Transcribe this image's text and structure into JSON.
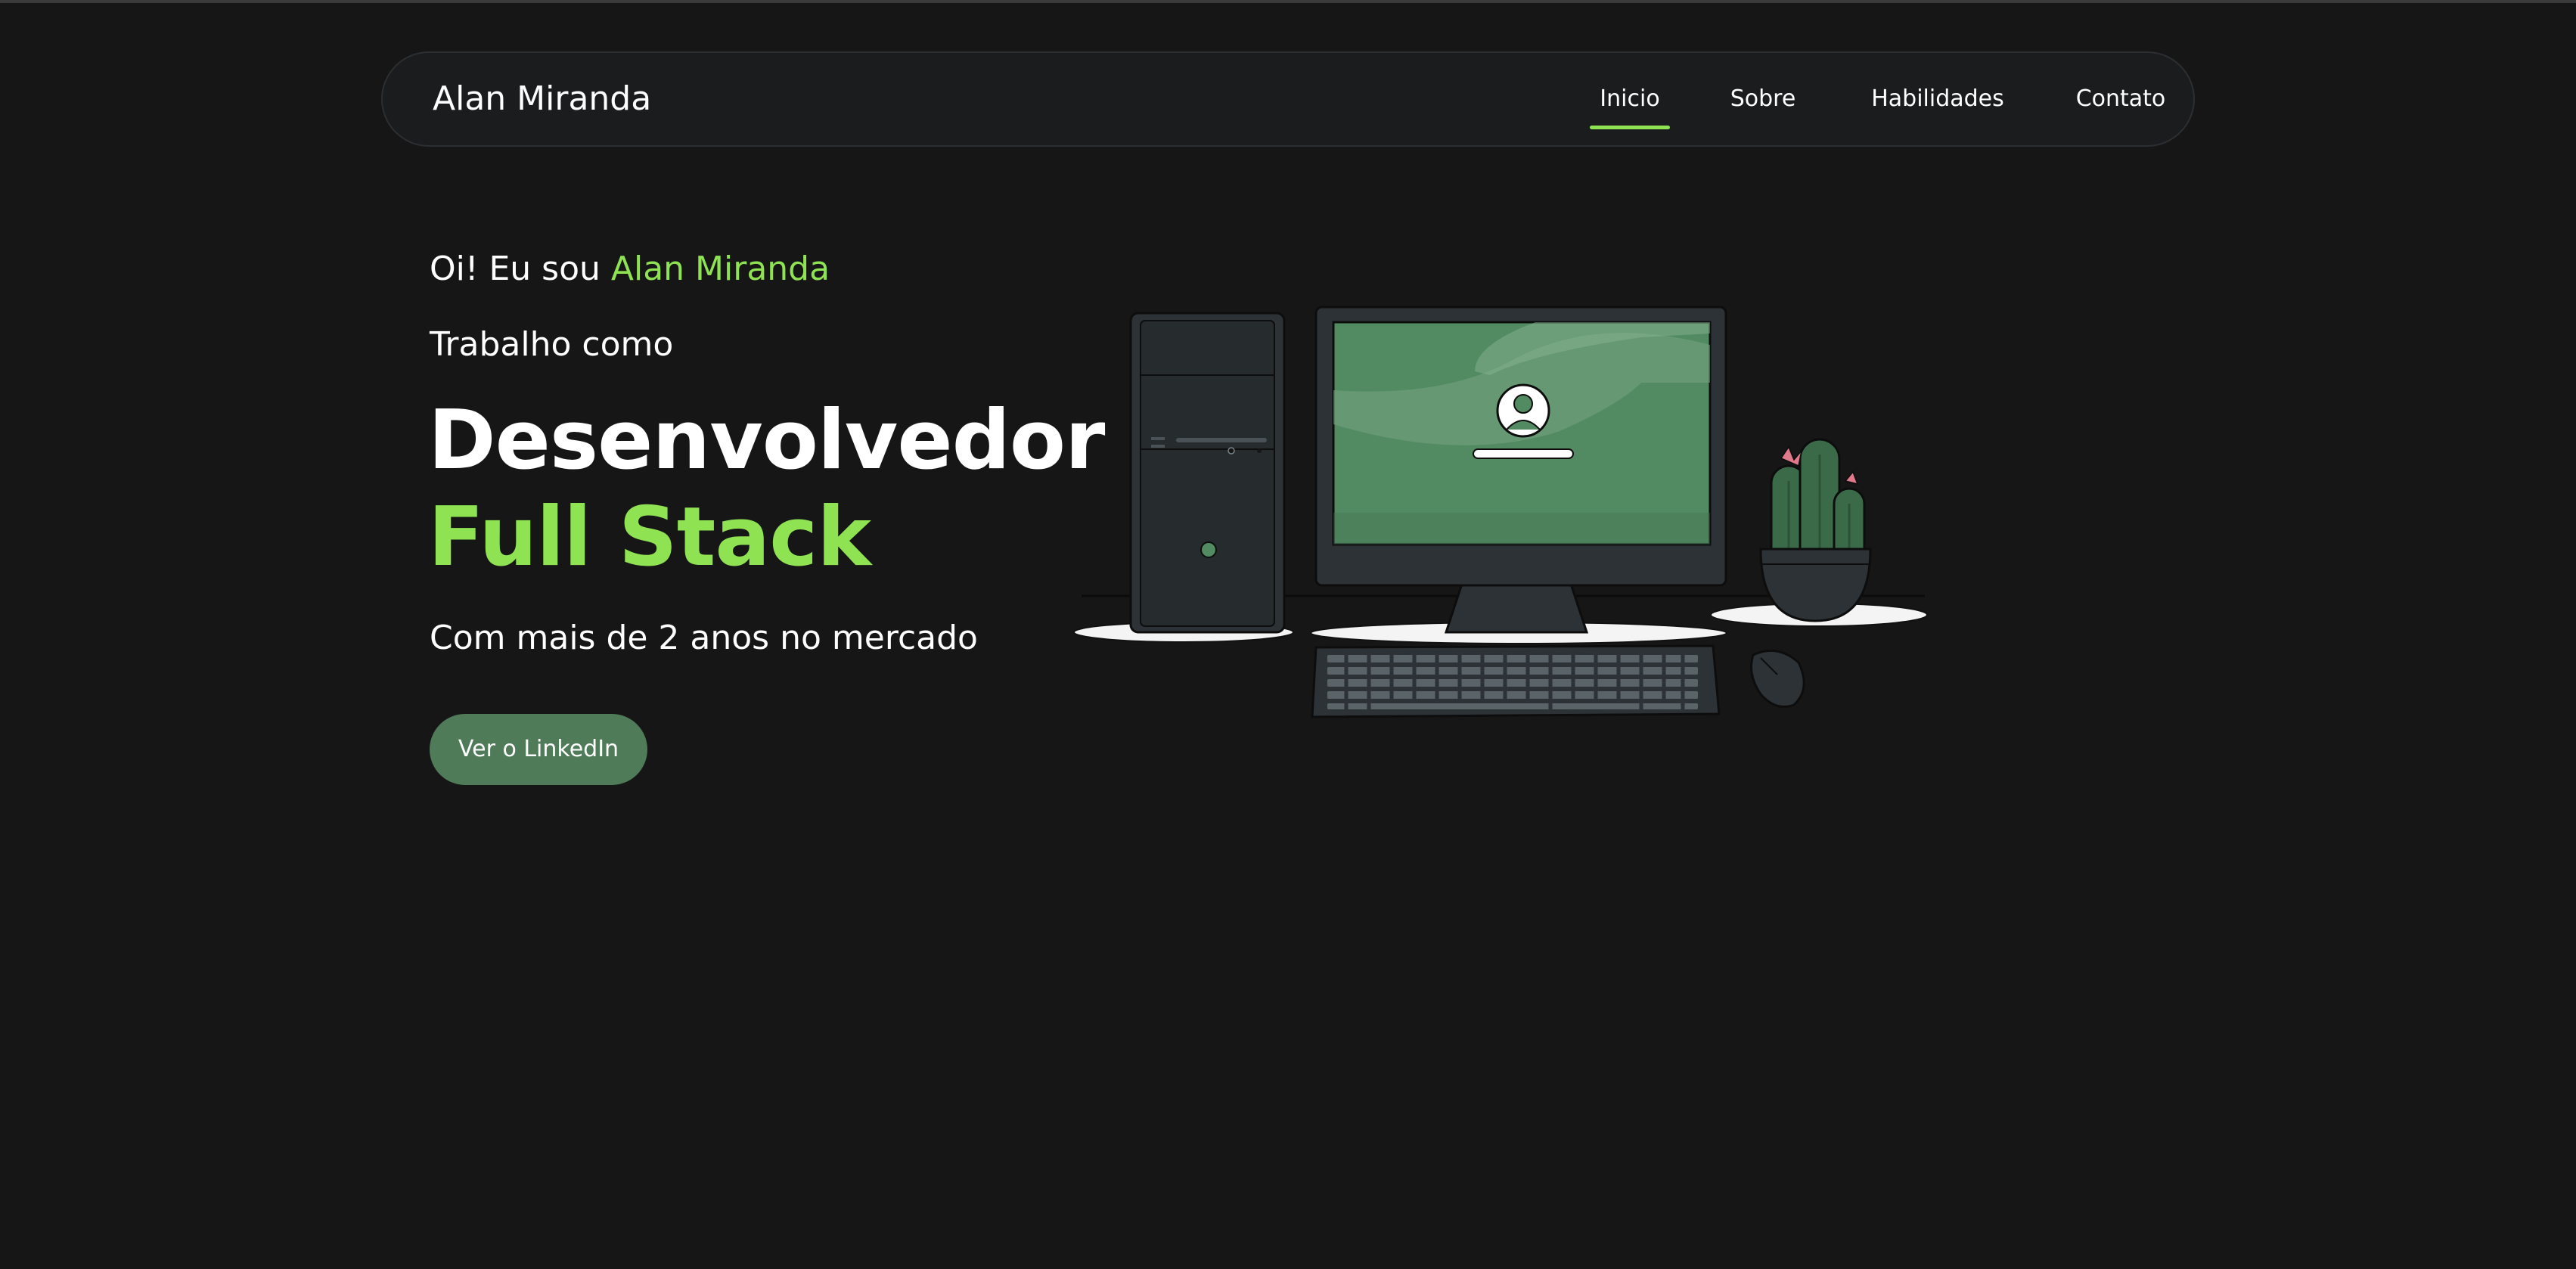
{
  "nav": {
    "brand": "Alan Miranda",
    "items": [
      {
        "label": "Inicio",
        "active": true
      },
      {
        "label": "Sobre",
        "active": false
      },
      {
        "label": "Habilidades",
        "active": false
      },
      {
        "label": "Contato",
        "active": false
      }
    ]
  },
  "hero": {
    "greeting_prefix": "Oi! Eu sou",
    "greeting_name": "Alan Miranda",
    "works_as": "Trabalho como",
    "role_line_1": "Desenvolvedor",
    "role_line_2": "Full Stack",
    "experience": "Com mais de 2 anos no mercado",
    "cta_label": "Ver o LinkedIn"
  },
  "illustration": {
    "name": "computer-desk-illustration",
    "icons": [
      "pc-tower-icon",
      "monitor-icon",
      "user-avatar-icon",
      "keyboard-icon",
      "mouse-icon",
      "cactus-plant-icon"
    ]
  },
  "colors": {
    "background": "#161616",
    "accent_green": "#8fe353",
    "button_green": "#4f7b59",
    "screen_green": "#528a61",
    "device_dark": "#2c3236"
  }
}
